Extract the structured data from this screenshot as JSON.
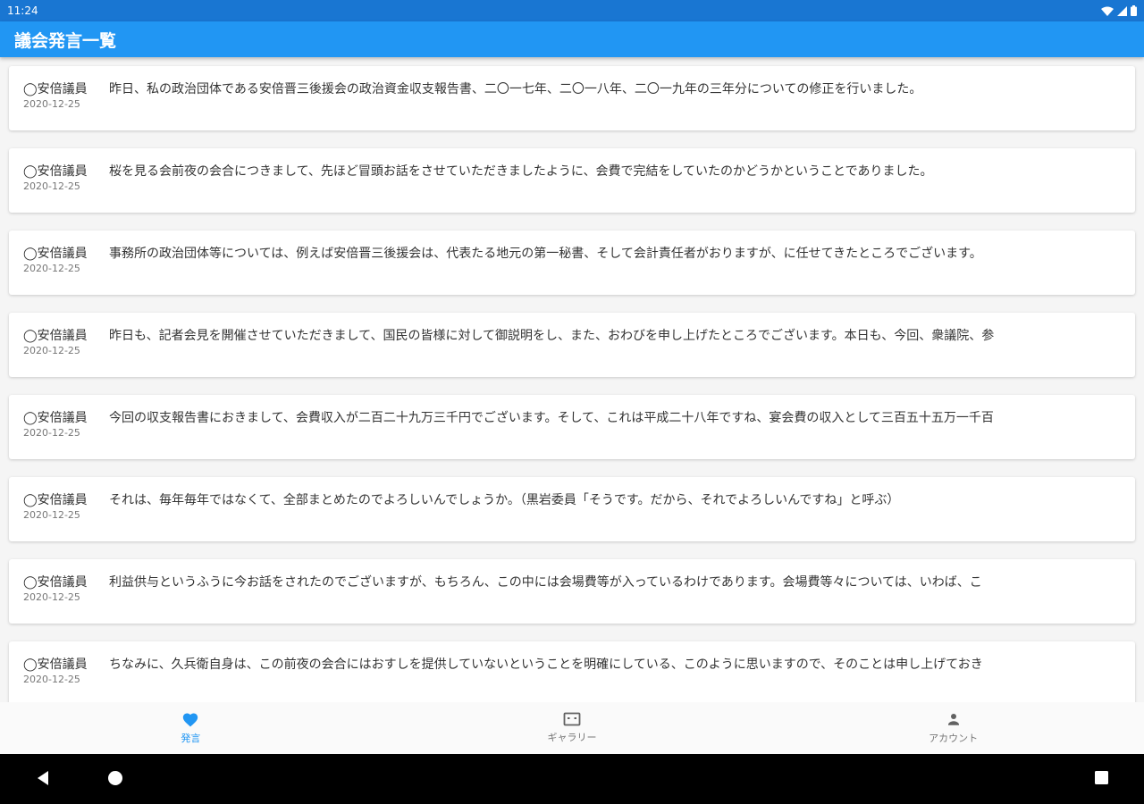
{
  "status_bar": {
    "time": "11:24"
  },
  "app_bar": {
    "title": "議会発言一覧"
  },
  "speeches": [
    {
      "speaker": "◯安倍議員",
      "date": "2020-12-25",
      "text": "昨日、私の政治団体である安倍晋三後援会の政治資金収支報告書、二〇一七年、二〇一八年、二〇一九年の三年分についての修正を行いました。"
    },
    {
      "speaker": "◯安倍議員",
      "date": "2020-12-25",
      "text": "桜を見る会前夜の会合につきまして、先ほど冒頭お話をさせていただきましたように、会費で完結をしていたのかどうかということでありました。"
    },
    {
      "speaker": "◯安倍議員",
      "date": "2020-12-25",
      "text": "事務所の政治団体等については、例えば安倍晋三後援会は、代表たる地元の第一秘書、そして会計責任者がおりますが、に任せてきたところでございます。"
    },
    {
      "speaker": "◯安倍議員",
      "date": "2020-12-25",
      "text": "昨日も、記者会見を開催させていただきまして、国民の皆様に対して御説明をし、また、おわびを申し上げたところでございます。本日も、今回、衆議院、参"
    },
    {
      "speaker": "◯安倍議員",
      "date": "2020-12-25",
      "text": "今回の収支報告書におきまして、会費収入が二百二十九万三千円でございます。そして、これは平成二十八年ですね、宴会費の収入として三百五十五万一千百"
    },
    {
      "speaker": "◯安倍議員",
      "date": "2020-12-25",
      "text": "それは、毎年毎年ではなくて、全部まとめたのでよろしいんでしょうか。（黒岩委員「そうです。だから、それでよろしいんですね」と呼ぶ）"
    },
    {
      "speaker": "◯安倍議員",
      "date": "2020-12-25",
      "text": "利益供与というふうに今お話をされたのでございますが、もちろん、この中には会場費等が入っているわけであります。会場費等々については、いわば、こ"
    },
    {
      "speaker": "◯安倍議員",
      "date": "2020-12-25",
      "text": "ちなみに、久兵衛自身は、この前夜の会合にはおすしを提供していないということを明確にしている、このように思いますので、そのことは申し上げておき"
    }
  ],
  "bottom_nav": [
    {
      "label": "発言",
      "icon": "heart-icon",
      "active": true
    },
    {
      "label": "ギャラリー",
      "icon": "gallery-icon",
      "active": false
    },
    {
      "label": "アカウント",
      "icon": "account-icon",
      "active": false
    }
  ],
  "colors": {
    "primary": "#2196f3",
    "status_bar": "#1976d2"
  }
}
